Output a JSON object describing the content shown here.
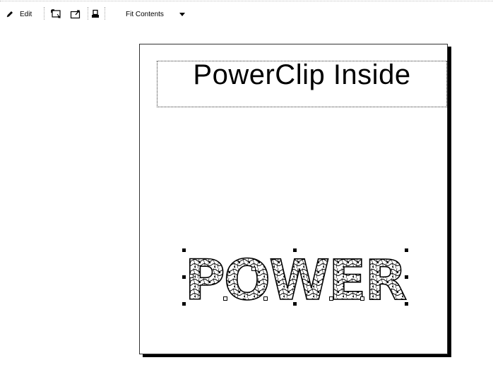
{
  "toolbar": {
    "edit_label": "Edit",
    "fit_label": "Fit Contents",
    "icons": [
      "pencil-icon",
      "select-contents-icon",
      "extract-contents-icon",
      "lock-contents-icon",
      "dropdown-arrow-icon"
    ]
  },
  "document": {
    "title_text": "PowerClip Inside",
    "clipped_word": "POWER"
  }
}
